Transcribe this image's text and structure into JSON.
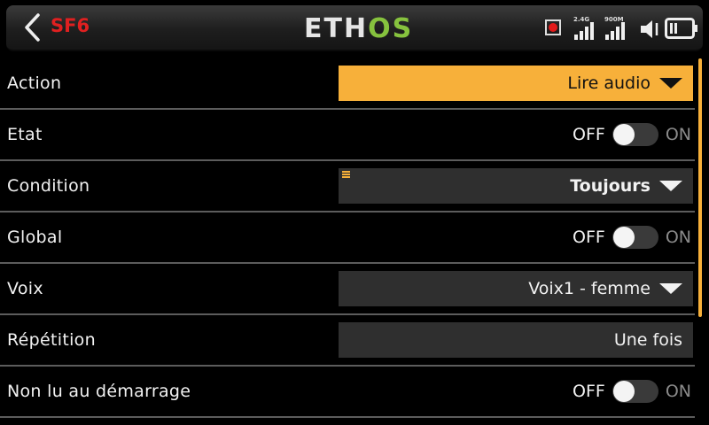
{
  "header": {
    "page_code": "SF6",
    "logo_left": "ETH",
    "logo_right": "OS",
    "signal1_label": "2.4G",
    "signal2_label": "900M",
    "icons": [
      "back-chevron-icon",
      "record-icon",
      "signal-bars-icon",
      "speaker-icon",
      "battery-icon"
    ]
  },
  "colors": {
    "accent": "#f7b03a",
    "page_code": "#e02020",
    "logo_os": "#86c23e"
  },
  "rows": {
    "action": {
      "label": "Action",
      "value": "Lire audio"
    },
    "etat": {
      "label": "Etat",
      "off": "OFF",
      "on": "ON"
    },
    "condition": {
      "label": "Condition",
      "value": "Toujours"
    },
    "global": {
      "label": "Global",
      "off": "OFF",
      "on": "ON"
    },
    "voix": {
      "label": "Voix",
      "value": "Voix1 - femme"
    },
    "repetition": {
      "label": "Répétition",
      "value": "Une fois"
    },
    "non_lu": {
      "label": "Non lu au démarrage",
      "off": "OFF",
      "on": "ON"
    }
  }
}
